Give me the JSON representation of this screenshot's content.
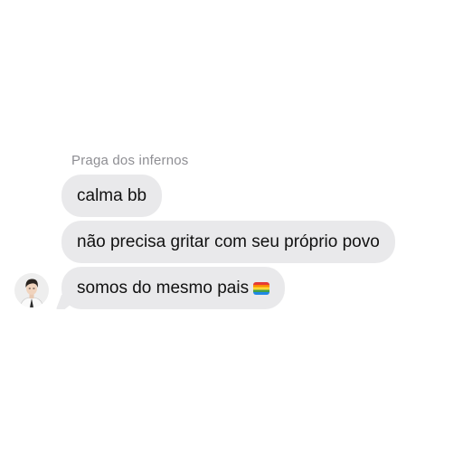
{
  "conversation": {
    "sender_name": "Praga dos infernos",
    "messages": [
      {
        "text": "calma bb",
        "emoji": ""
      },
      {
        "text": "não precisa gritar com seu próprio povo",
        "emoji": ""
      },
      {
        "text": "somos do mesmo pais",
        "emoji": "rainbow-flag-icon"
      }
    ]
  },
  "colors": {
    "bubble_background": "#e9e9eb",
    "sender_name_color": "#8e8e93",
    "message_text_color": "#111111",
    "page_background": "#ffffff"
  }
}
